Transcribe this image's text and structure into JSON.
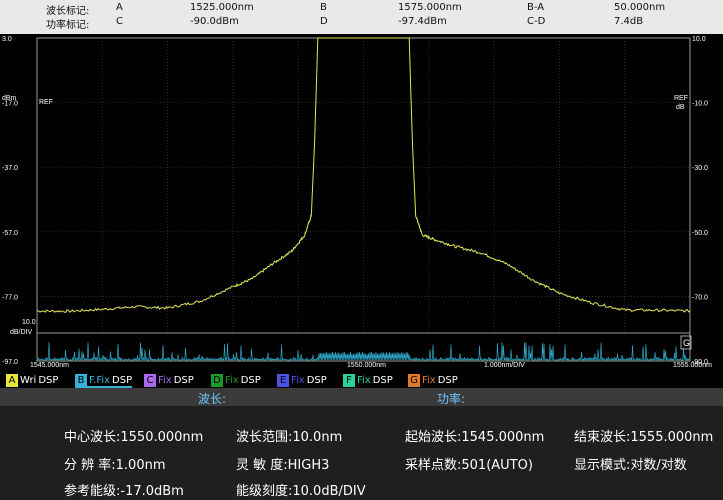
{
  "markers": {
    "row1": {
      "label": "波长标记:",
      "a_key": "A",
      "a_val": "1525.000nm",
      "b_key": "B",
      "b_val": "1575.000nm",
      "ba_key": "B-A",
      "ba_val": "50.000nm"
    },
    "row2": {
      "label": "功率标记:",
      "c_key": "C",
      "c_val": "-90.0dBm",
      "d_key": "D",
      "d_val": "-97.4dBm",
      "cd_key": "C-D",
      "cd_val": "7.4dB"
    }
  },
  "plot": {
    "ref_left": "REF",
    "ref_left_unit": "dBm",
    "ref_right": "REF",
    "ref_right_unit": "dB",
    "scale_label_left": "10.0",
    "scale_unit_left": "dB/DIV",
    "box_char": "G",
    "x_left": "1545.000nm",
    "x_center": "1550.000nm",
    "x_div": "1.000nm/DIV",
    "x_right": "1555.000nm"
  },
  "chart_data": {
    "type": "line",
    "x": [
      1545.0,
      1545.5,
      1546.0,
      1546.5,
      1547.0,
      1547.5,
      1548.0,
      1548.3,
      1548.6,
      1548.9,
      1549.1,
      1549.2,
      1549.25,
      1549.3,
      1549.4,
      1550.0,
      1550.6,
      1550.7,
      1550.75,
      1550.8,
      1550.9,
      1551.1,
      1551.4,
      1551.8,
      1552.2,
      1552.6,
      1553.0,
      1553.5,
      1554.0,
      1554.5,
      1555.0
    ],
    "series": [
      {
        "values": [
          -81.5,
          -81.6,
          -81.0,
          -80.2,
          -80.6,
          -78.5,
          -74.0,
          -71.5,
          -67.0,
          -63.0,
          -58.0,
          -52.0,
          -30.0,
          3.0,
          3.0,
          3.0,
          3.0,
          3.0,
          -30.0,
          -52.0,
          -58.0,
          -59.5,
          -61.5,
          -63.5,
          -67.0,
          -72.0,
          -76.0,
          -79.0,
          -81.2,
          -81.3,
          -81.5
        ]
      }
    ],
    "x_range": [
      1545.0,
      1555.0
    ],
    "y_left_ticks": [
      "3.0",
      "-17.0",
      "-37.0",
      "-57.0",
      "-77.0",
      "-97.0"
    ],
    "y_right_ticks": [
      "10.0",
      "-10.0",
      "-30.0",
      "-50.0",
      "-70.0",
      "-90.0"
    ],
    "ylim": [
      -97.0,
      3.0
    ],
    "grid": true,
    "trace_color": "#e4e45a"
  },
  "channels": [
    {
      "key": "A",
      "mode": "Wri",
      "disp": "DSP",
      "key_color": "#e8e83a",
      "mode_color": "#ffffff"
    },
    {
      "key": "B",
      "mode": "F.Fix",
      "disp": "DSP",
      "key_color": "#36b2d6",
      "mode_color": "#36b2d6"
    },
    {
      "key": "C",
      "mode": "Fix",
      "disp": "DSP",
      "key_color": "#a868f0",
      "mode_color": "#a868f0"
    },
    {
      "key": "D",
      "mode": "Fix",
      "disp": "DSP",
      "key_color": "#1f9a2a",
      "mode_color": "#1f9a2a"
    },
    {
      "key": "E",
      "mode": "Fix",
      "disp": "DSP",
      "key_color": "#4d52e6",
      "mode_color": "#4d52e6"
    },
    {
      "key": "F",
      "mode": "Fix",
      "disp": "DSP",
      "key_color": "#2ad29a",
      "mode_color": "#2ad29a"
    },
    {
      "key": "G",
      "mode": "Fix",
      "disp": "DSP",
      "key_color": "#e07a2a",
      "mode_color": "#e07a2a"
    }
  ],
  "tabs": {
    "wavelength": "波长:",
    "power": "功率:"
  },
  "params": {
    "center": "中心波长:1550.000nm",
    "span": "波长范围:10.0nm",
    "start": "起始波长:1545.000nm",
    "stop": "结束波长:1555.000nm",
    "resolution": "分 辨 率:1.00nm",
    "sensitivity": "灵 敏 度:HIGH3",
    "sampling": "采样点数:501(AUTO)",
    "display_mode": "显示模式:对数/对数",
    "ref_level": "参考能级:-17.0dBm",
    "level_scale": "能级刻度:10.0dB/DIV"
  }
}
